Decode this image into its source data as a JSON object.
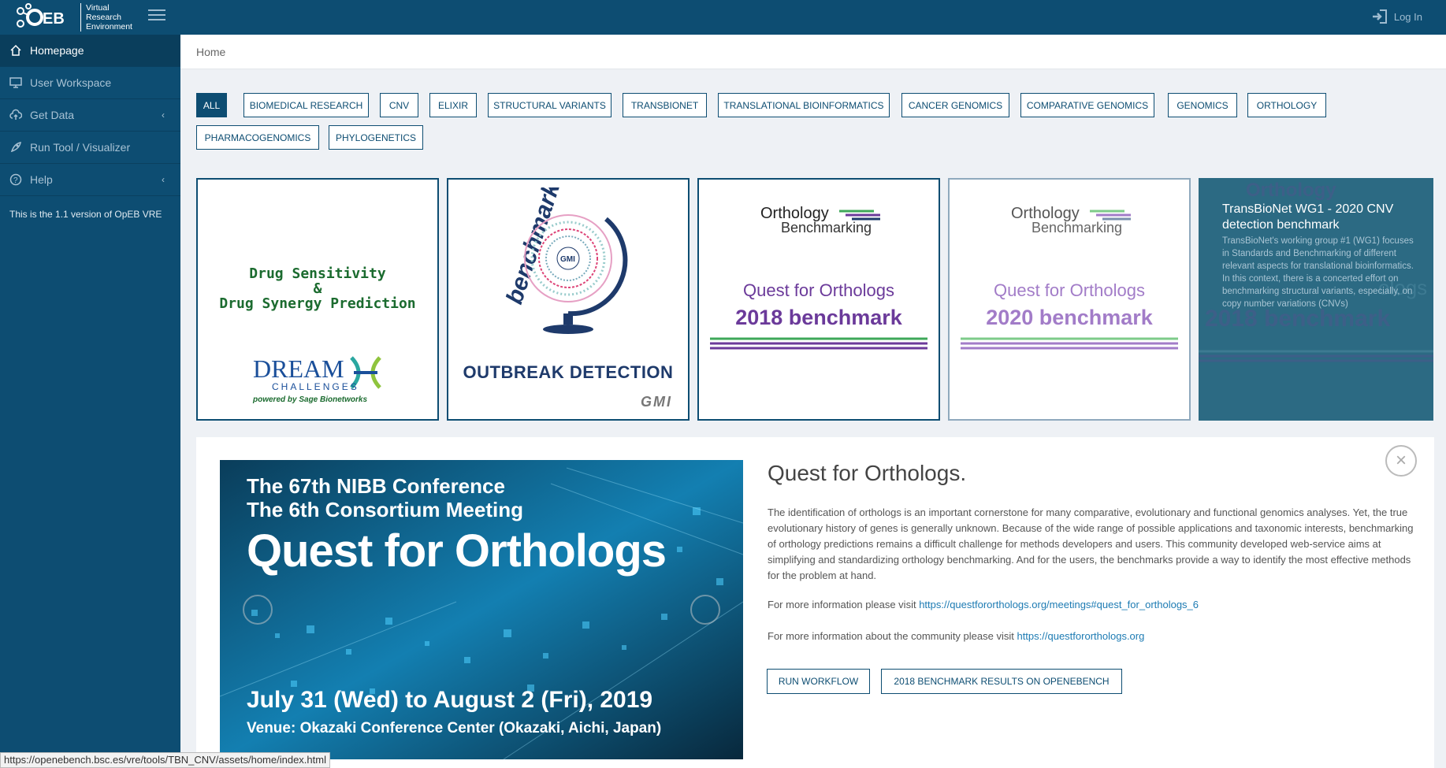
{
  "app": {
    "logo_text_1": "Virtual",
    "logo_text_2": "Research",
    "logo_text_3": "Environment",
    "login_label": "Log In"
  },
  "sidebar": {
    "items": [
      {
        "label": "Homepage",
        "icon": "home-icon"
      },
      {
        "label": "User Workspace",
        "icon": "monitor-icon"
      },
      {
        "label": "Get Data",
        "icon": "cloud-upload-icon"
      },
      {
        "label": "Run Tool / Visualizer",
        "icon": "rocket-icon"
      },
      {
        "label": "Help",
        "icon": "question-icon"
      }
    ],
    "version": "This is the 1.1 version of OpEB VRE"
  },
  "breadcrumb": "Home",
  "tags": [
    "ALL",
    "BIOMEDICAL RESEARCH",
    "CNV",
    "ELIXIR",
    "STRUCTURAL VARIANTS",
    "TRANSBIONET",
    "TRANSLATIONAL BIOINFORMATICS",
    "CANCER GENOMICS",
    "COMPARATIVE GENOMICS",
    "GENOMICS",
    "ORTHOLOGY",
    "PHARMACOGENOMICS",
    "PHYLOGENETICS"
  ],
  "cards": {
    "c1": {
      "line1": "Drug Sensitivity",
      "line2": "&",
      "line3": "Drug Synergy Prediction",
      "brand": "DREAM",
      "brand_sub": "CHALLENGES",
      "powered": "powered by Sage Bionetworks"
    },
    "c2": {
      "arc": "benchmarking",
      "globe_label": "GMI",
      "title": "OUTBREAK DETECTION",
      "corner": "GMI"
    },
    "c3": {
      "logo1": "Orthology",
      "logo2": "Benchmarking",
      "line1": "Quest for Orthologs",
      "line2": "2018 benchmark"
    },
    "c4": {
      "logo1": "Orthology",
      "logo2": "Benchmarking",
      "line1": "Quest for Orthologs",
      "line2": "2020 benchmark"
    },
    "c5": {
      "title": "TransBioNet WG1 - 2020 CNV detection benchmark",
      "desc": "TransBioNet's working group #1 (WG1) focuses in Standards and Benchmarking of different relevant aspects for translational bioinformatics. In this context, there is a concerted effort on benchmarking structural variants, especially, on copy number variations (CNVs)",
      "bg1": "Orthology",
      "bg2": "2018 benchmark",
      "bg3": "ologs"
    }
  },
  "detail": {
    "title": "Quest for Orthologs.",
    "body": "The identification of orthologs is an important cornerstone for many comparative, evolutionary and functional genomics analyses. Yet, the true evolutionary history of genes is generally unknown. Because of the wide range of possible applications and taxonomic interests, benchmarking of orthology predictions remains a difficult challenge for methods developers and users. This community developed web-service aims at simplifying and standardizing orthology benchmarking. And for the users, the benchmarks provide a way to identify the most effective methods for the problem at hand.",
    "info1_prefix": "For more information please visit ",
    "info1_link": "https://questfororthologs.org/meetings#quest_for_orthologs_6",
    "info2_prefix": "For more information about the community please visit ",
    "info2_link": "https://questfororthologs.org",
    "btn_run": "RUN WORKFLOW",
    "btn_results": "2018 BENCHMARK RESULTS ON OPENEBENCH",
    "banner": {
      "line1": "The 67th NIBB Conference",
      "line2": "The 6th Consortium Meeting",
      "line3": "Quest for Orthologs",
      "line4": "July 31 (Wed) to August 2 (Fri), 2019",
      "line5": "Venue: Okazaki Conference Center (Okazaki, Aichi, Japan)"
    }
  },
  "status_url": "https://openebench.bsc.es/vre/tools/TBN_CNV/assets/home/index.html",
  "colors": {
    "primary": "#0d4d72",
    "purple": "#6b3a9a",
    "green": "#3fa85a"
  }
}
